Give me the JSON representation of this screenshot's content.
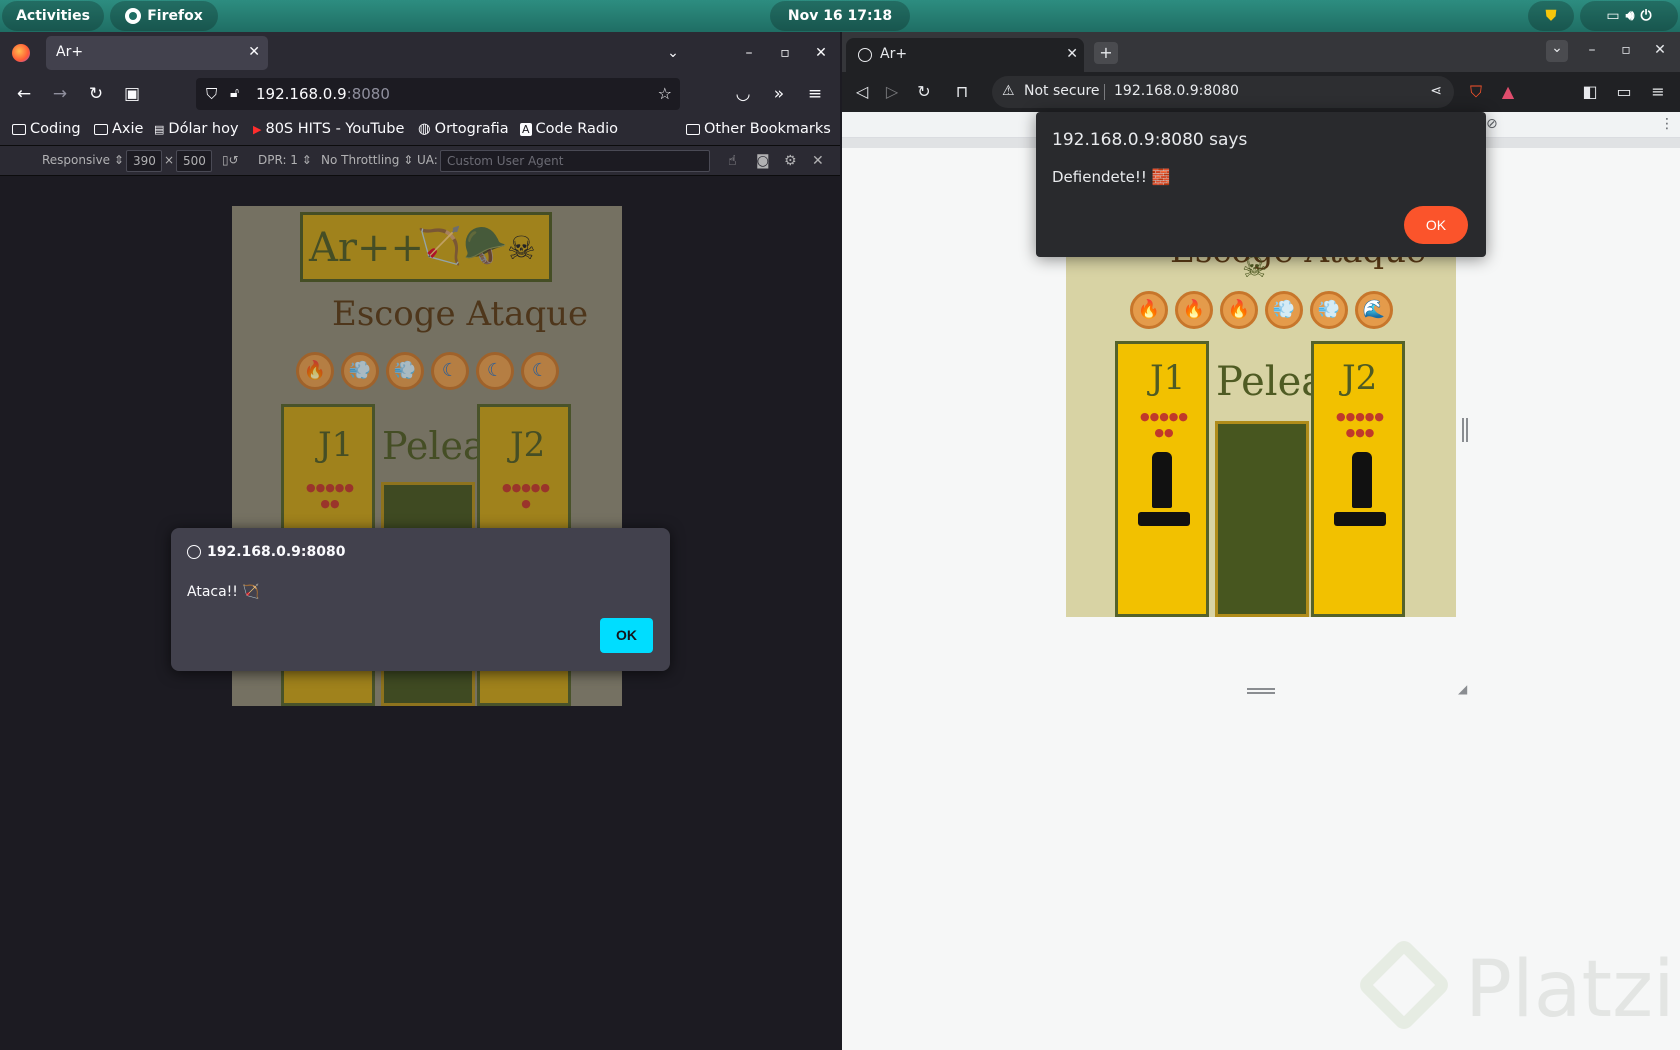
{
  "topbar": {
    "activities": "Activities",
    "app_name": "Firefox",
    "clock": "Nov 16  17:18"
  },
  "firefox": {
    "tab_title": "Ar+",
    "url_host": "192.168.0.9",
    "url_port": ":8080",
    "bookmarks": [
      "Coding",
      "Axie",
      "Dólar hoy",
      "80S HITS - YouTube",
      "Ortografia",
      "Code Radio"
    ],
    "other_bookmarks": "Other Bookmarks",
    "rdm": {
      "device": "Responsive",
      "width": "390",
      "times": "×",
      "height": "500",
      "dpr": "DPR: 1",
      "throttle": "No Throttling",
      "ua_label": "UA:",
      "ua_placeholder": "Custom User Agent"
    },
    "page": {
      "title": "Ar++",
      "subtitle": "Escoge Ataque",
      "p1": "J1",
      "p2": "J2",
      "center": "Pelea"
    },
    "dialog": {
      "host": "192.168.0.9:8080",
      "message": "Ataca!! 🏹",
      "ok": "OK"
    }
  },
  "brave": {
    "tab_title": "Ar+",
    "not_secure": "Not secure",
    "url": "192.168.0.9:8080",
    "page": {
      "subtitle": "Escoge Ataque",
      "p1": "J1",
      "p2": "J2",
      "center": "Pelea",
      "attacks": [
        "🔥",
        "🔥",
        "🔥",
        "💨",
        "💨",
        "🌊"
      ]
    },
    "dialog": {
      "title": "192.168.0.9:8080 says",
      "message": "Defiendete!! 🧱",
      "ok": "OK"
    },
    "watermark": "Platzi"
  },
  "colors": {
    "topbar": "#2d8d80",
    "firefox_accent": "#00ddff",
    "brave_accent": "#fb542b",
    "game_yellow": "#c9a017",
    "game_green": "#47561f"
  }
}
